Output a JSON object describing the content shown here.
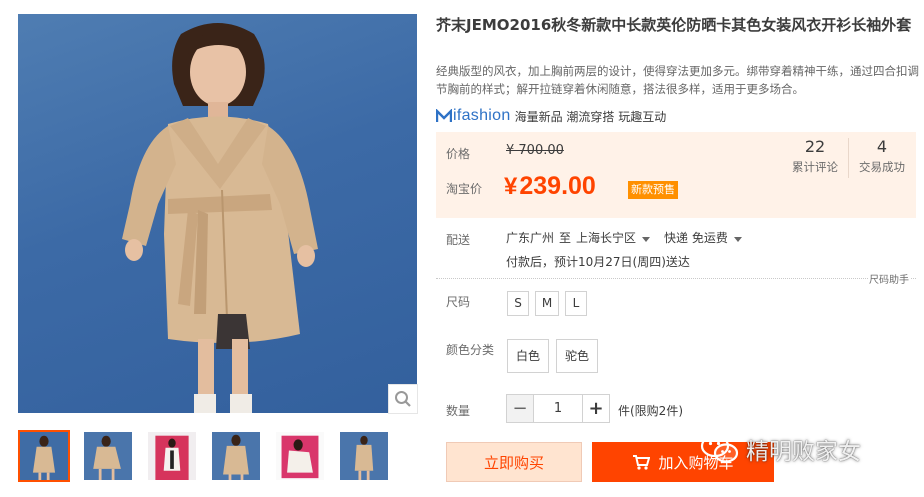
{
  "product": {
    "title": "芥末JEMO2016秋冬新款中长款英伦防晒卡其色女装风衣开衫长袖外套",
    "subtitle": "经典版型的风衣，加上胸前两层的设计，使得穿法更加多元。绑带穿着精神干练，通过四合扣调节胸前的样式；解开拉链穿着休闲随意，搭法很多样，适用于更多场合。"
  },
  "brand": {
    "logo_text": "ifashion",
    "tagline": "海量新品 潮流穿搭 玩趣互动",
    "logo_color": "#2e72c6"
  },
  "price": {
    "original_label": "价格",
    "original_value": "¥ 700.00",
    "current_label": "淘宝价",
    "currency": "¥",
    "current_value": "239.00",
    "promo_tag": "新款预售",
    "accent_color": "#ff4400"
  },
  "stats": [
    {
      "value": "22",
      "label": "累计评论"
    },
    {
      "value": "4",
      "label": "交易成功"
    }
  ],
  "shipping": {
    "label": "配送",
    "from": "广东广州",
    "to_word": "至",
    "to": "上海长宁区",
    "method": "快递 免运费",
    "eta": "付款后，预计10月27日(周四)送达"
  },
  "size_helper": "尺码助手",
  "size": {
    "label": "尺码",
    "options": [
      "S",
      "M",
      "L"
    ]
  },
  "color": {
    "label": "颜色分类",
    "options": [
      "白色",
      "驼色"
    ]
  },
  "quantity": {
    "label": "数量",
    "minus": "−",
    "value": "1",
    "plus": "+",
    "limit": "件(限购2件)"
  },
  "actions": {
    "buy_now": "立即购买",
    "add_cart": "加入购物车"
  },
  "watermark": "精明败家女",
  "icons": {
    "zoom": "magnifier-icon",
    "cart": "cart-icon",
    "wechat": "wechat-icon"
  }
}
